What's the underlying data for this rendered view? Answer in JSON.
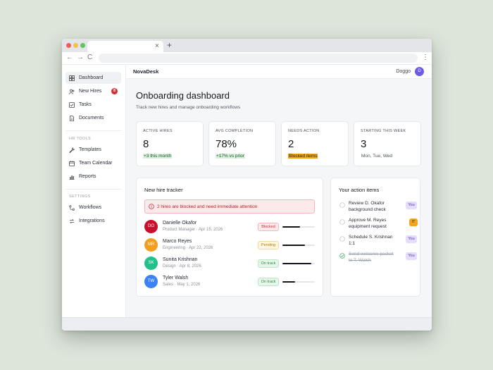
{
  "browser": {
    "tab_close": "×",
    "new_tab": "+",
    "back": "←",
    "forward": "→",
    "reload": "C",
    "menu": "⋮"
  },
  "app": {
    "brand": "NovaDesk",
    "user": {
      "name": "Doggo",
      "initial": "D",
      "avatar_color": "#6c5ce7"
    }
  },
  "sidebar": {
    "items": [
      {
        "label": "Dashboard",
        "icon": "grid-icon",
        "active": true
      },
      {
        "label": "New Hires",
        "icon": "users-icon",
        "badge": "8"
      },
      {
        "label": "Tasks",
        "icon": "checkbox-icon"
      },
      {
        "label": "Documents",
        "icon": "document-icon"
      }
    ],
    "hr_tools": {
      "title": "HR TOOLS",
      "items": [
        {
          "label": "Templates",
          "icon": "wrench-icon"
        },
        {
          "label": "Team Calendar",
          "icon": "calendar-icon"
        },
        {
          "label": "Reports",
          "icon": "bar-chart-icon"
        }
      ]
    },
    "settings": {
      "title": "SETTINGS",
      "items": [
        {
          "label": "Workflows",
          "icon": "workflow-icon"
        },
        {
          "label": "Integrations",
          "icon": "integration-icon"
        }
      ]
    }
  },
  "page": {
    "title": "Onboarding dashboard",
    "subtitle": "Track new hires and manage onboarding workflows"
  },
  "stats": [
    {
      "label": "ACTIVE HIRES",
      "value": "8",
      "note": "+3 this month",
      "note_style": "green"
    },
    {
      "label": "AVG COMPLETION",
      "value": "78%",
      "note": "+17% vs prior",
      "note_style": "green"
    },
    {
      "label": "NEEDS ACTION",
      "value": "2",
      "note": "Blocked items",
      "note_style": "orange"
    },
    {
      "label": "STARTING THIS WEEK",
      "value": "3",
      "note": "Mon, Tue, Wed",
      "note_style": "plain"
    }
  ],
  "tracker": {
    "title": "New hire tracker",
    "alert": "2 hires are blocked and need immediate attention",
    "hires": [
      {
        "initials": "DO",
        "name": "Danielle Okafor",
        "meta": "Product Manager · Apr 15, 2026",
        "status": "Blocked",
        "status_key": "blocked",
        "progress": 0.55,
        "color": "#c8102e"
      },
      {
        "initials": "MR",
        "name": "Marco Reyes",
        "meta": "Engineering · Apr 22, 2026",
        "status": "Pending",
        "status_key": "pending",
        "progress": 0.7,
        "color": "#f29f1f"
      },
      {
        "initials": "SK",
        "name": "Sunita Krishnan",
        "meta": "Design · Apr 8, 2026",
        "status": "On track",
        "status_key": "ontrack",
        "progress": 0.9,
        "color": "#22c08a"
      },
      {
        "initials": "TW",
        "name": "Tyler Walsh",
        "meta": "Sales · May 1, 2026",
        "status": "On track",
        "status_key": "ontrack",
        "progress": 0.4,
        "color": "#3b82f6"
      }
    ]
  },
  "actions": {
    "title": "Your action items",
    "items": [
      {
        "text": "Review D. Okafor background check",
        "tag": "You",
        "tag_key": "you",
        "done": false
      },
      {
        "text": "Approve M. Reyes equipment request",
        "tag": "IT",
        "tag_key": "it",
        "done": false
      },
      {
        "text": "Schedule S. Krishnan 1:1",
        "tag": "You",
        "tag_key": "you",
        "done": false
      },
      {
        "text": "Send welcome packet to T. Walsh",
        "tag": "You",
        "tag_key": "you",
        "done": true
      }
    ]
  }
}
